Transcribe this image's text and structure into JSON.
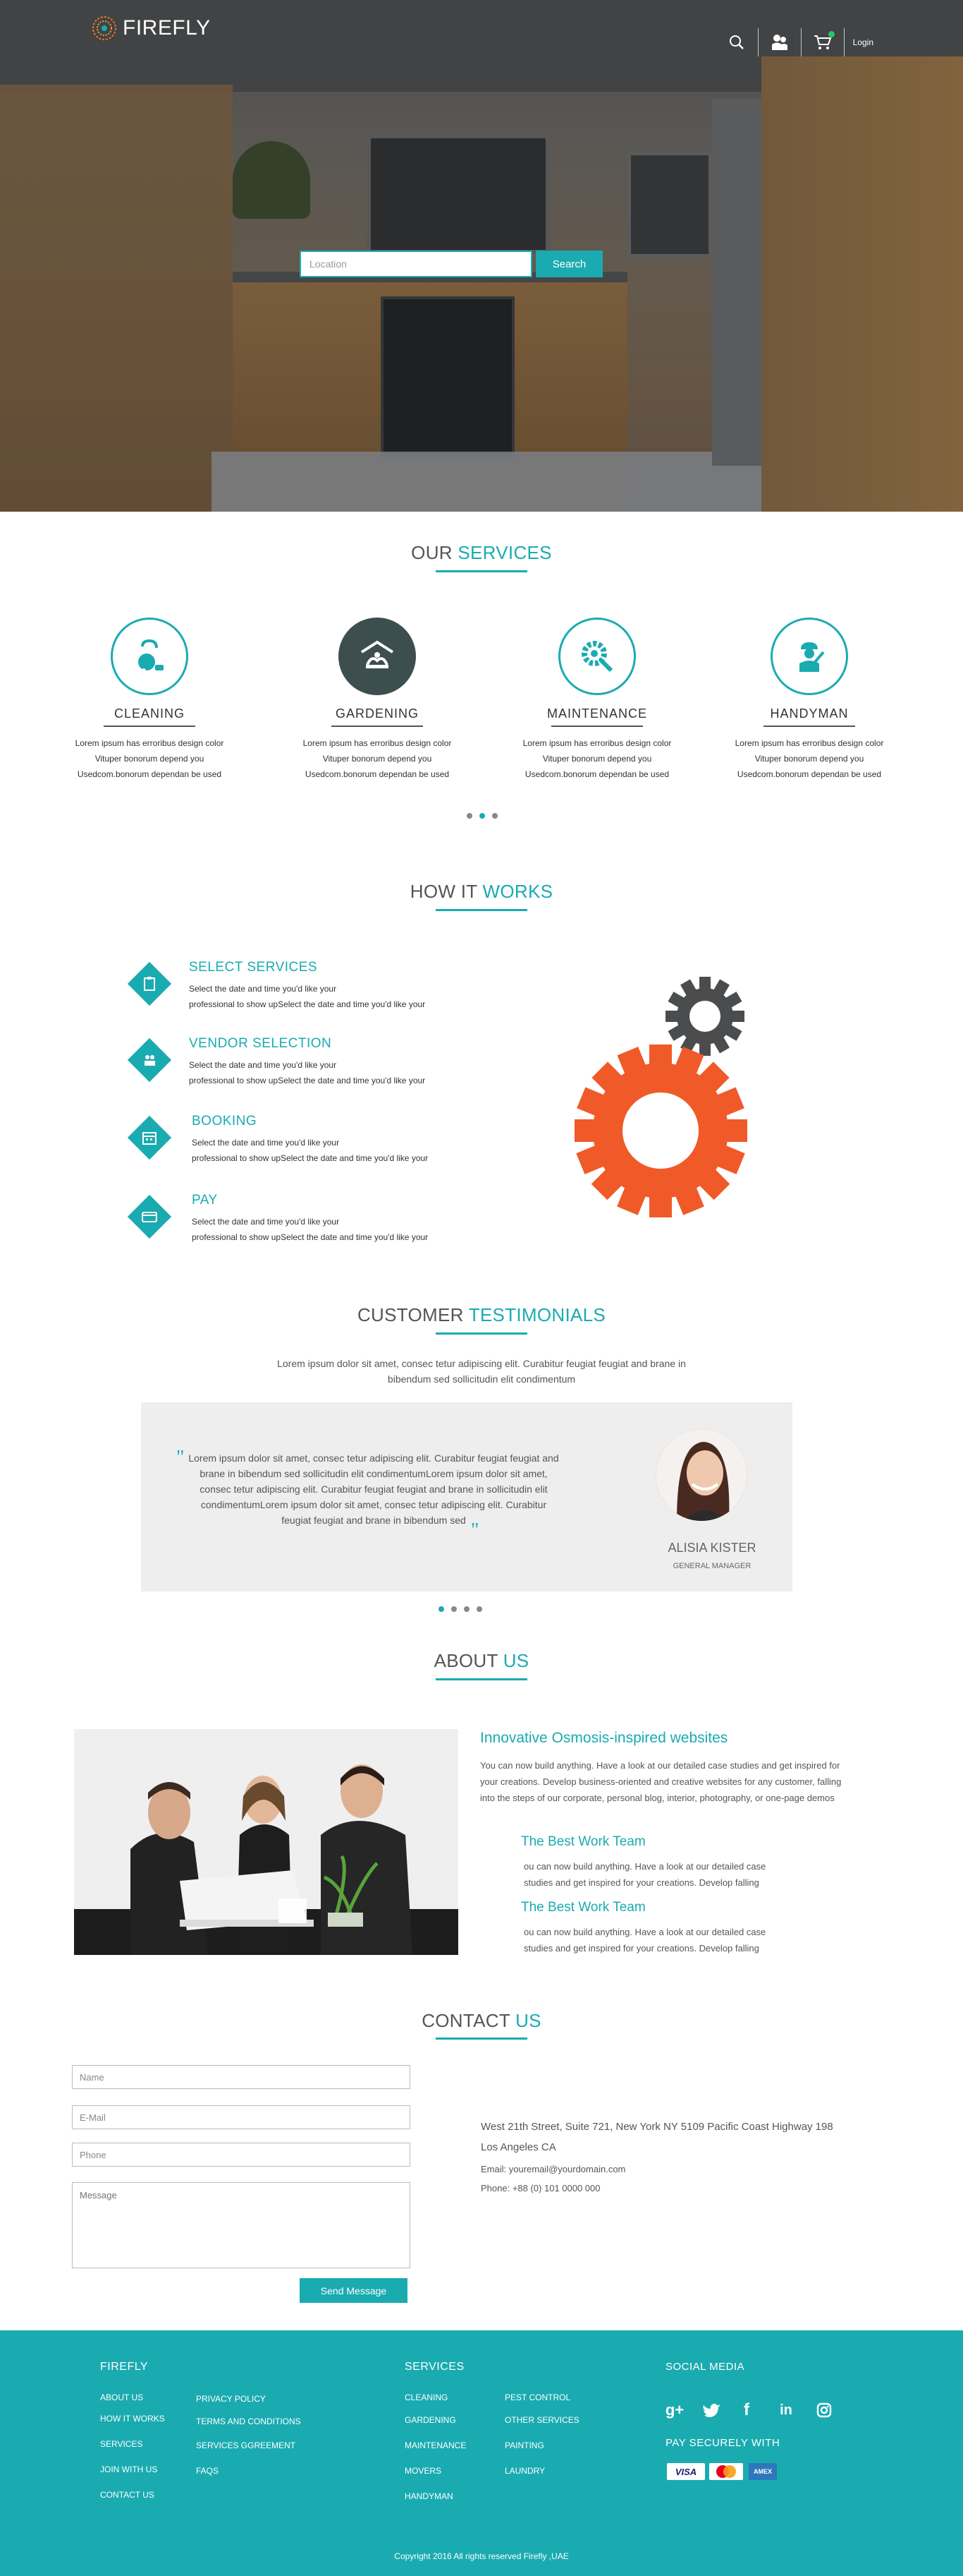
{
  "brand": {
    "name": "FIREFLY"
  },
  "nav": {
    "login_label": "Login",
    "cart_count": "",
    "icons": [
      "search-icon",
      "user-group-icon",
      "cart-icon"
    ]
  },
  "hero": {
    "search_placeholder": "Location",
    "search_button": "Search"
  },
  "services": {
    "title_a": "OUR",
    "title_b": "SERVICES",
    "items": [
      {
        "name": "CLEANING",
        "icon": "vacuum-cleaner-icon",
        "desc": [
          "Lorem ipsum has erroribus design color",
          "Vituper bonorum depend you",
          "Usedcom.bonorum dependan be used"
        ]
      },
      {
        "name": "GARDENING",
        "icon": "gardening-icon",
        "desc": [
          "Lorem ipsum has erroribus design color",
          "Vituper bonorum depend you",
          "Usedcom.bonorum dependan be used"
        ]
      },
      {
        "name": "MAINTENANCE",
        "icon": "maintenance-gear-icon",
        "desc": [
          "Lorem ipsum has erroribus design color",
          "Vituper bonorum depend you",
          "Usedcom.bonorum dependan be used"
        ]
      },
      {
        "name": "HANDYMAN",
        "icon": "handyman-icon",
        "desc": [
          "Lorem ipsum has erroribus design color",
          "Vituper bonorum depend you",
          "Usedcom.bonorum dependan be used"
        ]
      }
    ],
    "active_dot": 1
  },
  "how": {
    "title_a": "HOW IT",
    "title_b": "WORKS",
    "steps": [
      {
        "title": "SELECT SERVICES",
        "icon": "clipboard-icon",
        "l1": "Select the date and time you'd like your",
        "l2": "professional to show upSelect the date and time you'd like your"
      },
      {
        "title": "VENDOR SELECTION",
        "icon": "vendor-icon",
        "l1": "Select the date and time you'd like your",
        "l2": "professional to show upSelect the date and time you'd like your"
      },
      {
        "title": "BOOKING",
        "icon": "calendar-icon",
        "l1": "Select the date and time you'd like your",
        "l2": "professional to show upSelect the date and time you'd like your"
      },
      {
        "title": "PAY",
        "icon": "credit-card-icon",
        "l1": "Select the date and time you'd like your",
        "l2": "professional to show upSelect the date and time you'd like your"
      }
    ]
  },
  "testimonials": {
    "title_a": "CUSTOMER",
    "title_b": "TESTIMONIALS",
    "intro_l1": "Lorem ipsum dolor sit amet, consec tetur adipiscing elit. Curabitur feugiat feugiat and brane in",
    "intro_l2": "bibendum sed sollicitudin elit condimentum",
    "quote": [
      "Lorem ipsum dolor sit amet, consec tetur adipiscing elit. Curabitur feugiat feugiat and",
      "brane in bibendum sed sollicitudin elit condimentumLorem ipsum dolor sit amet,",
      "consec tetur adipiscing elit. Curabitur feugiat feugiat and brane in  sollicitudin elit",
      "condimentumLorem ipsum dolor sit amet, consec tetur adipiscing elit. Curabitur",
      "feugiat feugiat and brane in bibendum sed"
    ],
    "name": "ALISIA KISTER",
    "role": "GENERAL MANAGER",
    "active_dot": 0
  },
  "about": {
    "title_a": "ABOUT",
    "title_b": "US",
    "heading": "Innovative Osmosis-inspired websites",
    "text": [
      "You can now build anything. Have a look at our detailed case studies and get inspired for",
      "your creations. Develop business-oriented and creative websites for any customer, falling",
      "into the steps of our corporate, personal blog, interior, photography, or one-page demos"
    ],
    "sub1_title": "The Best Work Team",
    "sub1_text": [
      "ou can now build anything. Have a look at our detailed case",
      "studies and get inspired for your creations. Develop  falling"
    ],
    "sub2_title": "The Best Work Team",
    "sub2_text": [
      "ou can now build anything. Have a look at our detailed case",
      "studies and get inspired for your creations. Develop  falling"
    ]
  },
  "contact": {
    "title_a": "CONTACT",
    "title_b": "US",
    "name_ph": "Name",
    "email_ph": "E-Mail",
    "phone_ph": "Phone",
    "message_ph": "Message",
    "send": "Send Message",
    "address_l1": "West 21th Street, Suite 721, New York NY 5109 Pacific Coast Highway 198",
    "address_l2": "Los Angeles CA",
    "email": "Email: youremail@yourdomain.com",
    "phone": "Phone: +88 (0) 101 0000 000"
  },
  "footer": {
    "col1_title": "FIREFLY",
    "col1a": [
      "ABOUT US",
      "HOW IT WORKS",
      "SERVICES",
      "JOIN WITH US",
      "CONTACT US"
    ],
    "col1b": [
      "PRIVACY POLICY",
      "TERMS AND CONDITIONS",
      "SERVICES GGREEMENT",
      "FAQS"
    ],
    "col2_title": "SERVICES",
    "col2a": [
      "CLEANING",
      "GARDENING",
      "MAINTENANCE",
      "MOVERS",
      "HANDYMAN"
    ],
    "col2b": [
      "PEST CONTROL",
      "OTHER SERVICES",
      "PAINTING",
      "LAUNDRY"
    ],
    "social_title": "SOCIAL MEDIA",
    "social": [
      "google-plus-icon",
      "twitter-icon",
      "facebook-icon",
      "linkedin-icon",
      "instagram-icon"
    ],
    "pay_title": "PAY SECURELY WITH",
    "cards": [
      "VISA",
      "mastercard",
      "AMEX"
    ],
    "copyright": "Copyright 2016 All rights reserved Firefly ,UAE"
  },
  "colors": {
    "accent": "#1aabb1",
    "gear_orange": "#f05a28",
    "gear_dark": "#4a4c4e",
    "footer": "#1aabb1"
  }
}
